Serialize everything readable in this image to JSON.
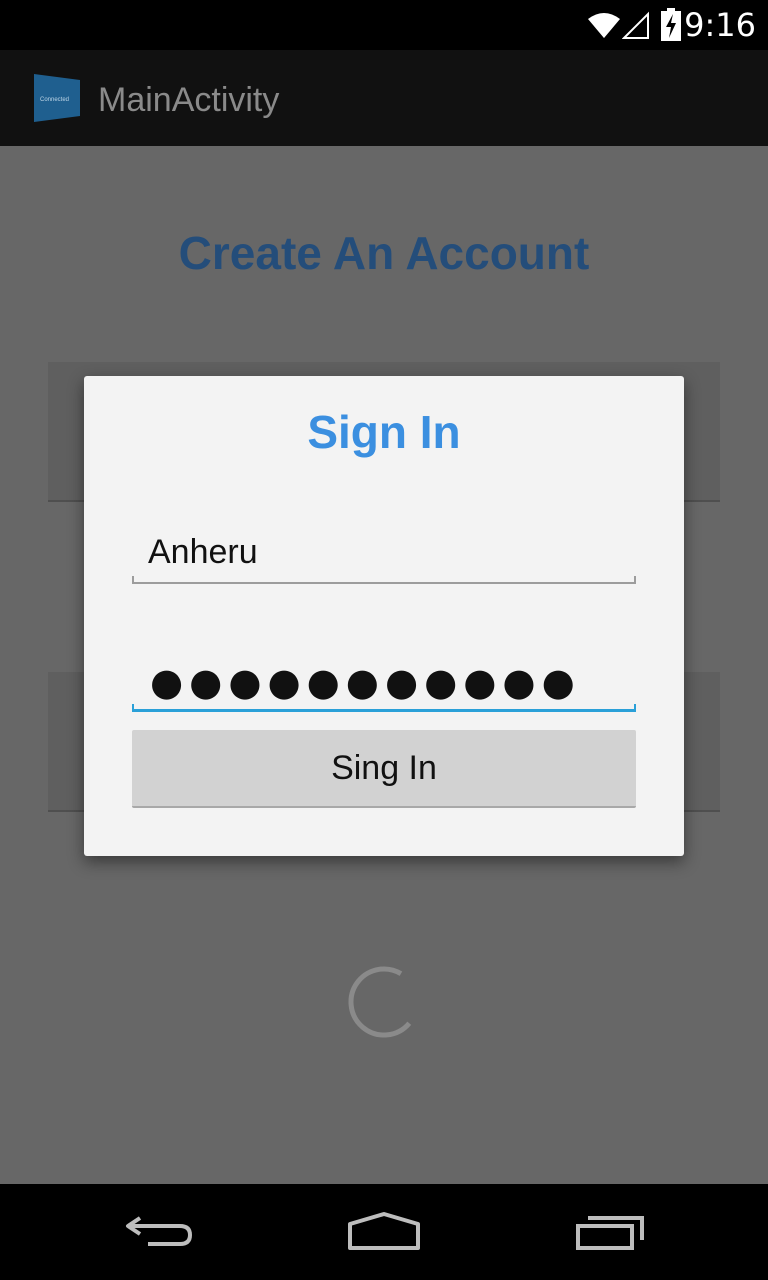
{
  "status_bar": {
    "time": "9:16",
    "icons": [
      "wifi-icon",
      "signal-icon",
      "battery-charging-icon"
    ]
  },
  "action_bar": {
    "title": "MainActivity",
    "app_icon": "app-icon",
    "app_icon_text": "Connected"
  },
  "page": {
    "heading": "Create An Account"
  },
  "dialog": {
    "title": "Sign In",
    "username_value": "Anheru",
    "password_masked": "●●●●●●●●●●●",
    "password_length": 11,
    "submit_label": "Sing In"
  },
  "colors": {
    "heading": "#244d7a",
    "dialog_title": "#3b8fe0",
    "focus_underline": "#2aa0d8",
    "dialog_background": "#f3f3f3",
    "scrim": "#676767"
  },
  "nav_bar": {
    "icons": [
      "back-icon",
      "home-icon",
      "recents-icon"
    ]
  }
}
